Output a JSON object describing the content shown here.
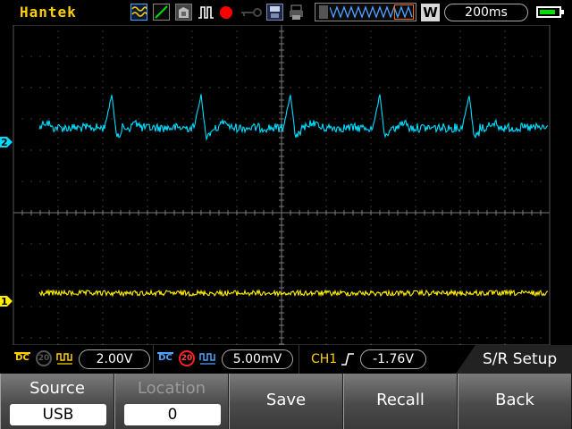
{
  "brand": "Hantek",
  "toolbar": {
    "icons": [
      "acquire-waveform-icon",
      "trigger-mode-icon",
      "persistence-icon",
      "pulse-icon",
      "record-icon",
      "key-icon",
      "save-disk-icon",
      "print-icon"
    ]
  },
  "timebase": "200ms",
  "run_badge": "W",
  "battery_level": 0.75,
  "channels": {
    "ch1": {
      "marker": "1",
      "color": "#ffee00",
      "coupling": "DC",
      "bw_limit": "20",
      "volts_div": "2.00V"
    },
    "ch2": {
      "marker": "2",
      "color": "#00dcff",
      "coupling": "DC",
      "bw_limit": "20",
      "volts_div": "5.00mV"
    }
  },
  "trigger": {
    "source": "CH1",
    "level": "-1.76V"
  },
  "menu": {
    "title": "S/R Setup",
    "buttons": [
      {
        "label": "Source",
        "value": "USB",
        "enabled": true
      },
      {
        "label": "Location",
        "value": "0",
        "enabled": false
      },
      {
        "label": "Save"
      },
      {
        "label": "Recall"
      },
      {
        "label": "Back"
      }
    ]
  }
}
